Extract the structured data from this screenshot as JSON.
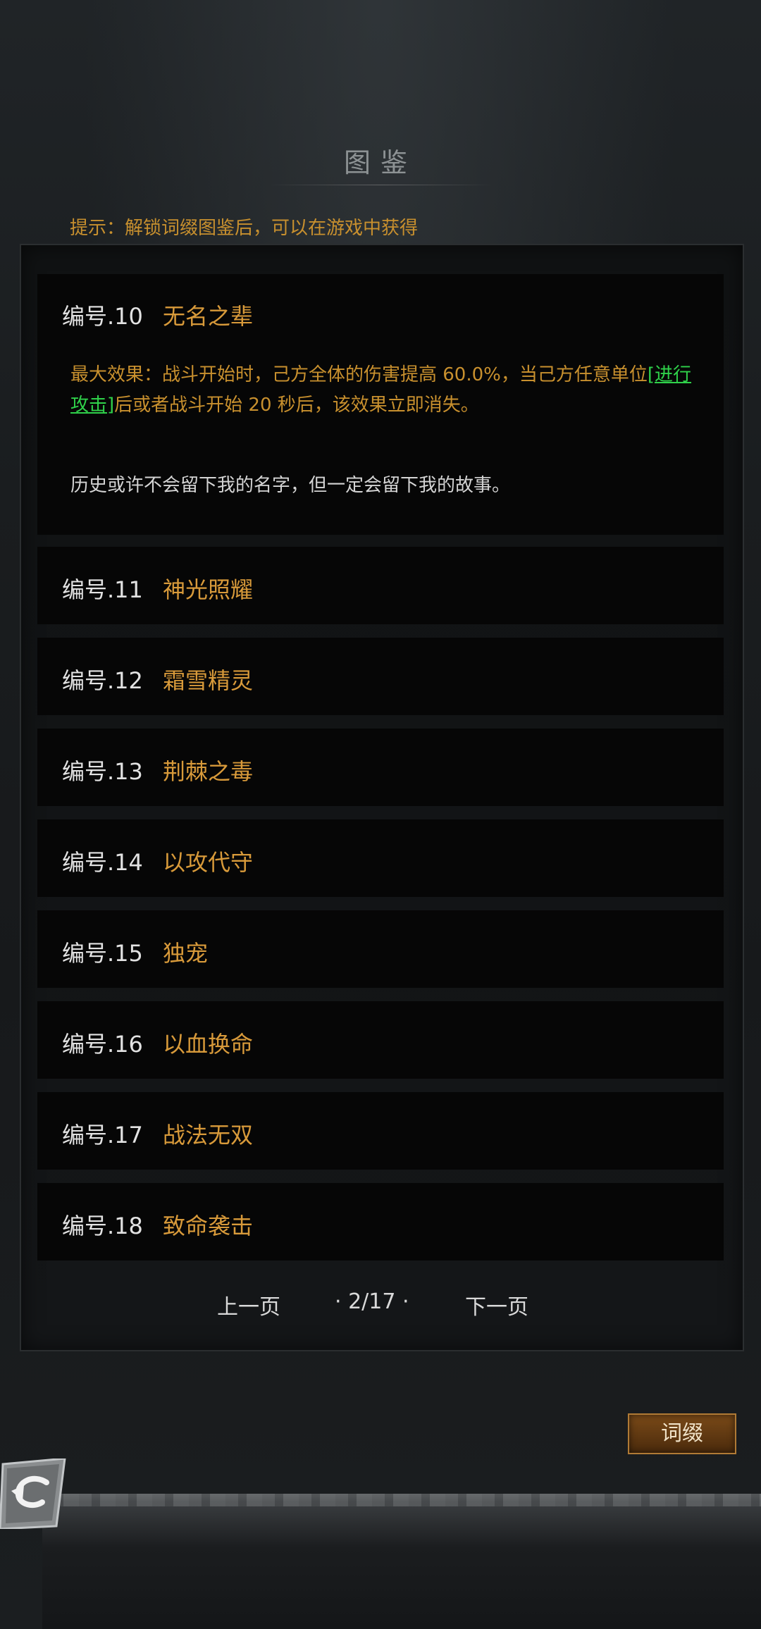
{
  "header": {
    "title": "图鉴",
    "hint": "提示：解锁词缀图鉴后，可以在游戏中获得"
  },
  "entries": [
    {
      "num": "编号.10",
      "name": "无名之辈",
      "expanded": true,
      "effect_prefix": "最大效果：战斗开始时，己方全体的伤害提高 60.0%，当己方任意单位",
      "effect_link": "[进行攻击]",
      "effect_suffix": "后或者战斗开始 20 秒后，该效果立即消失。",
      "story": "历史或许不会留下我的名字，但一定会留下我的故事。"
    },
    {
      "num": "编号.11",
      "name": "神光照耀"
    },
    {
      "num": "编号.12",
      "name": "霜雪精灵"
    },
    {
      "num": "编号.13",
      "name": "荆棘之毒"
    },
    {
      "num": "编号.14",
      "name": "以攻代守"
    },
    {
      "num": "编号.15",
      "name": "独宠"
    },
    {
      "num": "编号.16",
      "name": "以血换命"
    },
    {
      "num": "编号.17",
      "name": "战法无双"
    },
    {
      "num": "编号.18",
      "name": "致命袭击"
    }
  ],
  "pagination": {
    "prev_label": "上一页",
    "indicator": "· 2/17 ·",
    "next_label": "下一页"
  },
  "footer": {
    "affix_button_label": "词缀",
    "back_icon": "back-arrow-icon"
  },
  "colors": {
    "accent": "#d89a3a",
    "hint": "#c8902e",
    "link": "#2fd14a",
    "row_bg": "#060606"
  }
}
